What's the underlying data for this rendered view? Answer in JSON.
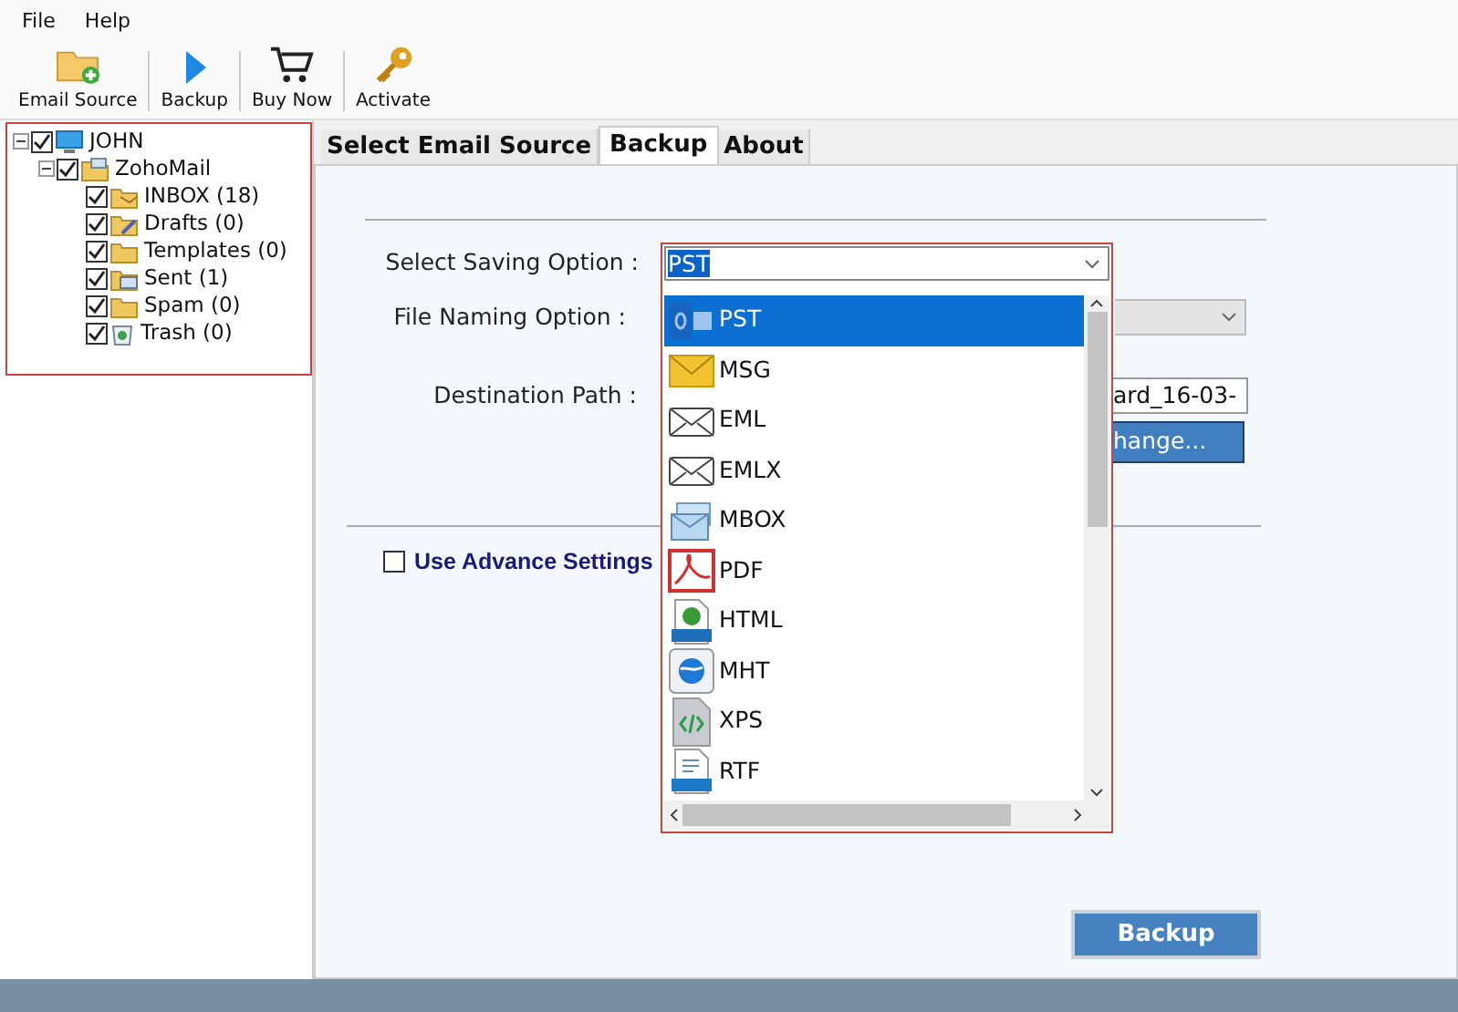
{
  "menu": [
    "File",
    "Help"
  ],
  "toolbar": [
    {
      "label": "Email Source",
      "kind": "folder"
    },
    {
      "label": "Backup",
      "kind": "play"
    },
    {
      "label": "Buy Now",
      "kind": "cart"
    },
    {
      "label": "Activate",
      "kind": "key"
    }
  ],
  "tree": [
    {
      "label": "JOHN",
      "kind": "computer",
      "checked": true,
      "expanded": true,
      "children": [
        {
          "label": "ZohoMail",
          "kind": "account",
          "checked": true,
          "expanded": true,
          "children": [
            {
              "label": "INBOX (18)",
              "kind": "inbox",
              "checked": true
            },
            {
              "label": "Drafts (0)",
              "kind": "drafts",
              "checked": true
            },
            {
              "label": "Templates (0)",
              "kind": "folder",
              "checked": true
            },
            {
              "label": "Sent (1)",
              "kind": "sent",
              "checked": true
            },
            {
              "label": "Spam (0)",
              "kind": "folder",
              "checked": true
            },
            {
              "label": "Trash (0)",
              "kind": "trash",
              "checked": true
            }
          ]
        }
      ]
    }
  ],
  "tabs": [
    {
      "label": "Select Email Source",
      "selected": false
    },
    {
      "label": "Backup",
      "selected": true
    },
    {
      "label": "About",
      "selected": false
    }
  ],
  "form": {
    "saving_option": {
      "label": "Select Saving Option :",
      "value": "PST",
      "options": [
        {
          "label": "PST",
          "kind": "pst",
          "selected": true
        },
        {
          "label": "MSG",
          "kind": "msg",
          "selected": false
        },
        {
          "label": "EML",
          "kind": "eml",
          "selected": false
        },
        {
          "label": "EMLX",
          "kind": "eml",
          "selected": false
        },
        {
          "label": "MBOX",
          "kind": "mbox",
          "selected": false
        },
        {
          "label": "PDF",
          "kind": "pdf",
          "selected": false
        },
        {
          "label": "HTML",
          "kind": "html",
          "selected": false
        },
        {
          "label": "MHT",
          "kind": "mht",
          "selected": false
        },
        {
          "label": "XPS",
          "kind": "xps",
          "selected": false
        },
        {
          "label": "RTF",
          "kind": "rtf",
          "selected": false
        }
      ]
    },
    "naming_option": {
      "label": "File Naming Option :"
    },
    "destination": {
      "label": "Destination Path :",
      "value": "ard_16-03-"
    },
    "change_button": "hange...",
    "advanced": {
      "label": "Use Advance Settings",
      "checked": false
    }
  },
  "backup_button": "Backup"
}
